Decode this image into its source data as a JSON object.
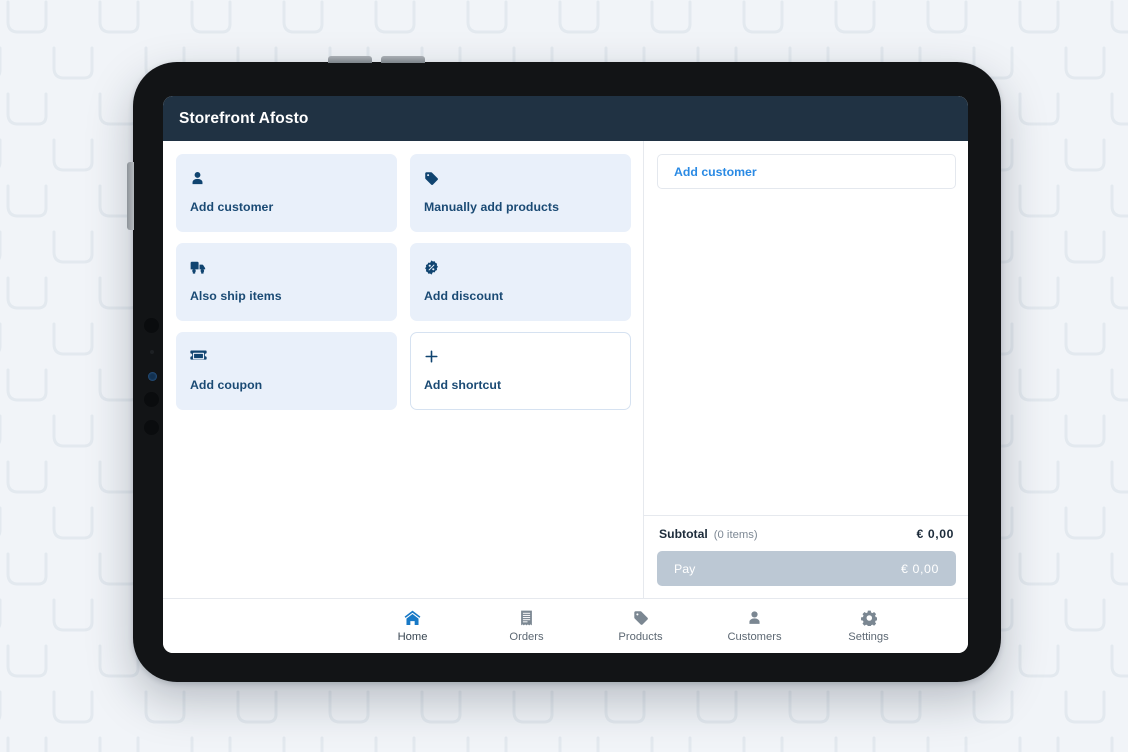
{
  "app": {
    "title": "Storefront Afosto"
  },
  "shortcuts": [
    {
      "label": "Add customer",
      "icon": "person-icon",
      "style": "filled"
    },
    {
      "label": "Manually add products",
      "icon": "tag-icon",
      "style": "filled"
    },
    {
      "label": "Also ship items",
      "icon": "truck-icon",
      "style": "filled"
    },
    {
      "label": "Add discount",
      "icon": "badge-percent-icon",
      "style": "filled"
    },
    {
      "label": "Add coupon",
      "icon": "ticket-icon",
      "style": "filled"
    },
    {
      "label": "Add shortcut",
      "icon": "plus-icon",
      "style": "outline"
    }
  ],
  "cart": {
    "add_customer_label": "Add customer",
    "subtotal_label": "Subtotal",
    "subtotal_items": "(0 items)",
    "subtotal_amount": "€  0,00",
    "pay_label": "Pay",
    "pay_amount": "€  0,00"
  },
  "nav": [
    {
      "label": "Home",
      "icon": "home-icon",
      "active": true
    },
    {
      "label": "Orders",
      "icon": "receipt-icon",
      "active": false
    },
    {
      "label": "Products",
      "icon": "tag-icon",
      "active": false
    },
    {
      "label": "Customers",
      "icon": "person-icon",
      "active": false
    },
    {
      "label": "Settings",
      "icon": "gear-icon",
      "active": false
    }
  ],
  "colors": {
    "header_bg": "#203243",
    "card_bg": "#e9f0fa",
    "card_text": "#1a4a74",
    "icon": "#104470",
    "link": "#2a8ae4",
    "pay_disabled": "#bcc8d4",
    "nav_active": "#1879c6"
  }
}
